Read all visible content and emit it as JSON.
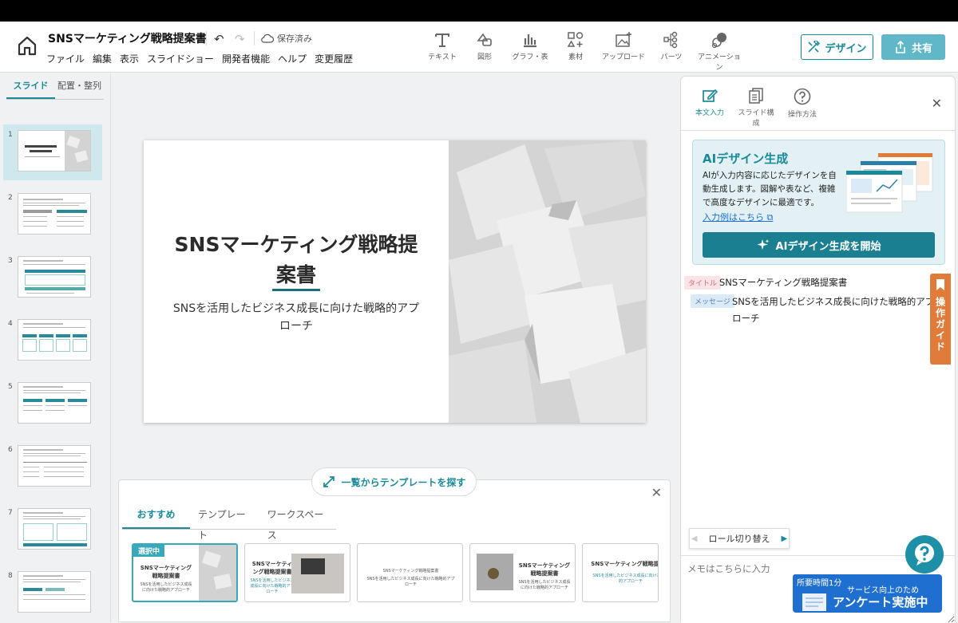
{
  "header": {
    "doc_title": "SNSマーケティング戦略提案書",
    "save_status": "保存済み",
    "menu": [
      "ファイル",
      "編集",
      "表示",
      "スライドショー",
      "開発者機能",
      "ヘルプ",
      "変更履歴"
    ],
    "tools": [
      "テキスト",
      "図形",
      "グラフ・表",
      "素材",
      "アップロード",
      "パーツ",
      "アニメーション"
    ],
    "design_label": "デザイン",
    "share_label": "共有"
  },
  "sidebar": {
    "tabs": [
      "スライド",
      "配置・整列"
    ],
    "slide_numbers": [
      "1",
      "2",
      "3",
      "4",
      "5",
      "6",
      "7",
      "8"
    ]
  },
  "slide": {
    "title": "SNSマーケティング戦略提案書",
    "subtitle": "SNSを活用したビジネス成長に向けた戦略的アプローチ"
  },
  "templates": {
    "search_label": "一覧からテンプレートを探す",
    "tabs": [
      "おすすめ",
      "テンプレート",
      "ワークスペース"
    ],
    "selected_badge": "選択中",
    "card_title": "SNSマーケティング戦略提案書",
    "card_sub": "SNSを活用したビジネス成長に向けた戦略的アプローチ"
  },
  "right_panel": {
    "tabs": [
      "本文入力",
      "スライド構成",
      "操作方法"
    ],
    "ai_title": "AIデザイン生成",
    "ai_desc": "AIが入力内容に応じたデザインを自動生成します。図解や表など、複雑で高度なデザインに最適です。",
    "ai_link": "入力例はこちら",
    "ai_button": "AIデザイン生成を開始",
    "title_tag": "タイトル",
    "title_value": "SNSマーケティング戦略提案書",
    "message_tag": "メッセージ",
    "message_value": "SNSを活用したビジネス成長に向けた戦略的アプローチ",
    "guide_label": "操作ガイド",
    "role_toggle": "ロール切り替え",
    "memo_placeholder": "メモはこちらに入力"
  },
  "survey": {
    "time": "所要時間1分",
    "small": "サービス向上のため",
    "big": "アンケート実施中"
  },
  "colors": {
    "accent": "#1a8a9b",
    "accent_dark": "#1a7f91",
    "guide": "#e07b3a",
    "survey": "#1f6fd0"
  }
}
